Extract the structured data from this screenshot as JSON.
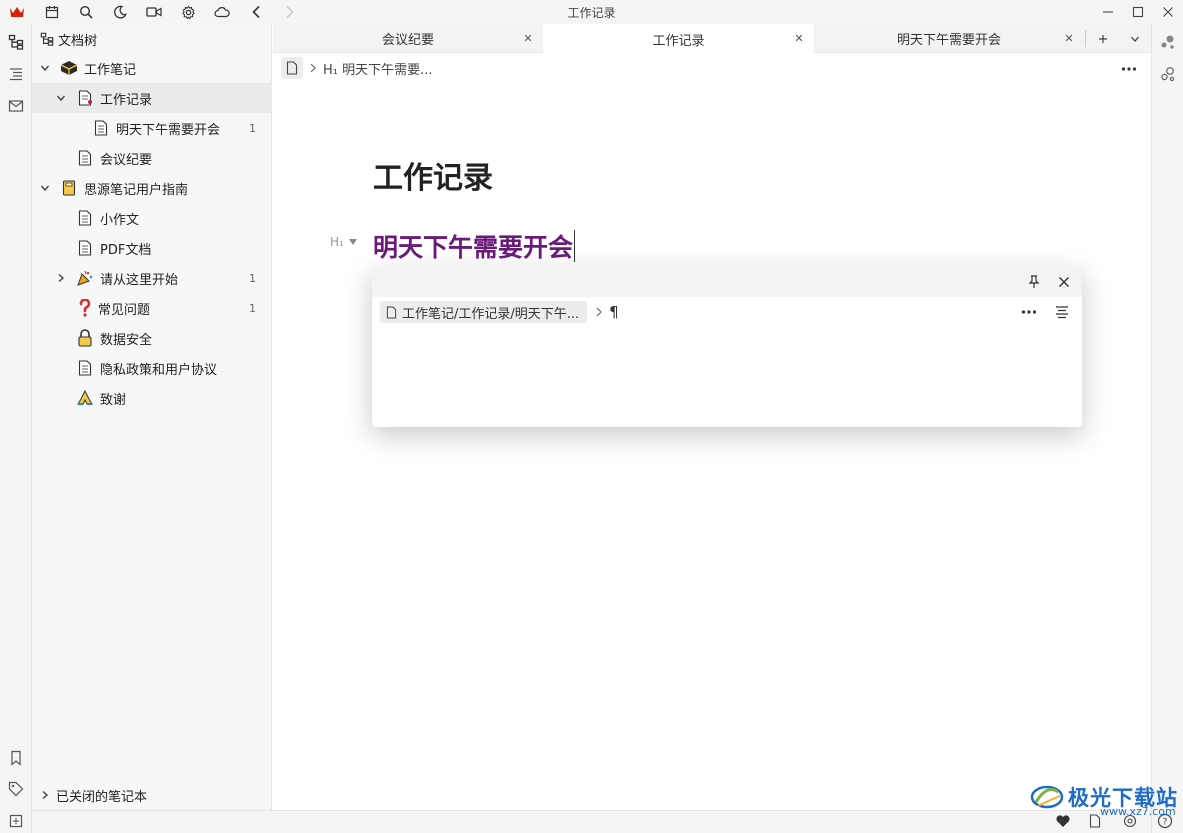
{
  "window": {
    "title": "工作记录"
  },
  "sidebar": {
    "header": "文档树",
    "tree": [
      {
        "label": "工作笔记"
      },
      {
        "label": "工作记录"
      },
      {
        "label": "明天下午需要开会",
        "count": "1"
      },
      {
        "label": "会议纪要"
      },
      {
        "label": "思源笔记用户指南"
      },
      {
        "label": "小作文"
      },
      {
        "label": "PDF文档"
      },
      {
        "label": "请从这里开始",
        "count": "1"
      },
      {
        "label": "常见问题",
        "count": "1"
      },
      {
        "label": "数据安全"
      },
      {
        "label": "隐私政策和用户协议"
      },
      {
        "label": "致谢"
      }
    ],
    "closed_notebooks": "已关闭的笔记本"
  },
  "tabs": [
    {
      "label": "会议纪要"
    },
    {
      "label": "工作记录"
    },
    {
      "label": "明天下午需要开会"
    }
  ],
  "editor": {
    "breadcrumb_heading": "H₁ 明天下午需要...",
    "title": "工作记录",
    "heading_marker": "H₁",
    "heading": "明天下午需要开会"
  },
  "popup": {
    "path": "工作笔记/工作记录/明天下午...",
    "block_mark": "¶"
  },
  "watermark": {
    "text": "极光下载站",
    "sub": "www.xz7.com"
  },
  "colors": {
    "heading": "#6a1b79",
    "logo": "#d81e06",
    "selected_row": "#e9ebec"
  }
}
